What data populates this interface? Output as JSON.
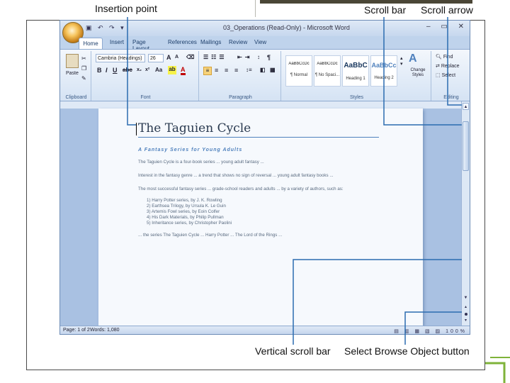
{
  "callouts": {
    "insertion_point": "Insertion point",
    "scroll_bar": "Scroll bar",
    "scroll_arrow": "Scroll arrow",
    "vertical_scroll_bar": "Vertical scroll bar",
    "select_browse_object": "Select Browse Object button"
  },
  "window": {
    "title": "03_Operations (Read-Only) - Microsoft Word",
    "controls": "– ▭ ✕"
  },
  "tabs": [
    "Home",
    "Insert",
    "Page Layout",
    "References",
    "Mailings",
    "Review",
    "View"
  ],
  "ribbon": {
    "paste": "Paste",
    "font_name": "Cambria (Headings)",
    "font_size": "26",
    "change_styles": "Change Styles",
    "find": "Find",
    "replace": "Replace",
    "select": "Select",
    "groups": {
      "clipboard": "Clipboard",
      "font": "Font",
      "paragraph": "Paragraph",
      "styles": "Styles",
      "editing": "Editing"
    },
    "styles": [
      {
        "sample": "AaBbCcDc",
        "name": "¶ Normal"
      },
      {
        "sample": "AaBbCcDc",
        "name": "¶ No Spaci..."
      },
      {
        "sample": "AaBbC",
        "name": "Heading 1"
      },
      {
        "sample": "AaBbCc",
        "name": "Heading 2"
      }
    ]
  },
  "document": {
    "heading": "The Taguien Cycle",
    "subtitle": "A Fantasy Series for Young Adults",
    "para1": "The Taguien Cycle is a four-book series ... young adult fantasy ...",
    "para2": "Interest in the fantasy genre ... a trend that shows no sign of reversal ... young adult fantasy books ...",
    "para3": "The most successful fantasy series ... grade-school readers and adults ... by a variety of authors, such as:",
    "list": [
      "1)   Harry Potter series, by J. K. Rowling",
      "2)   Earthsea Trilogy, by Ursula K. Le Guin",
      "3)   Artemis Fowl series, by Eoin Colfer",
      "4)   His Dark Materials, by Philip Pullman",
      "5)   Inheritance series, by Christopher Paolini"
    ],
    "para4": "... the series The Taguien Cycle ... Harry Potter ... The Lord of the Rings ..."
  },
  "status": {
    "page": "Page: 1 of 2",
    "words": "Words: 1,080",
    "zoom": "100%"
  }
}
